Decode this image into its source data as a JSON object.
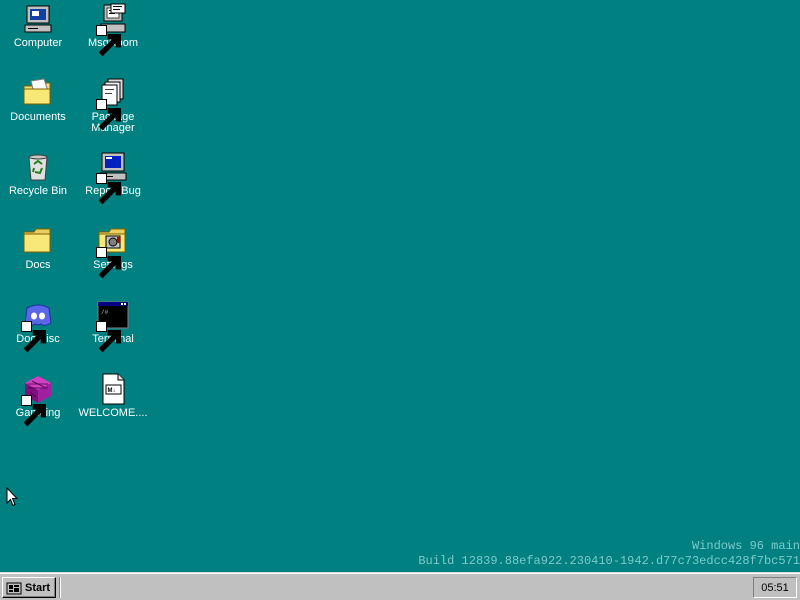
{
  "desktop": {
    "background_color": "#008080",
    "icons": [
      {
        "label": "Computer",
        "icon": "computer-icon",
        "shortcut": false
      },
      {
        "label": "MsgRoom",
        "icon": "msgroom-icon",
        "shortcut": true
      },
      {
        "label": "Documents",
        "icon": "documents-folder-icon",
        "shortcut": false
      },
      {
        "label": "Package Manager",
        "icon": "package-manager-icon",
        "shortcut": true
      },
      {
        "label": "Recycle Bin",
        "icon": "recycle-bin-icon",
        "shortcut": false
      },
      {
        "label": "Report Bug",
        "icon": "report-bug-icon",
        "shortcut": true
      },
      {
        "label": "Docs",
        "icon": "folder-icon",
        "shortcut": false
      },
      {
        "label": "Settings",
        "icon": "settings-icon",
        "shortcut": true
      },
      {
        "label": "Doordisc",
        "icon": "doordisc-icon",
        "shortcut": true
      },
      {
        "label": "Terminal",
        "icon": "terminal-icon",
        "shortcut": true
      },
      {
        "label": "Gameing",
        "icon": "gameing-icon",
        "shortcut": true
      },
      {
        "label": "WELCOME....",
        "icon": "markdown-file-icon",
        "shortcut": false
      }
    ]
  },
  "watermark": {
    "line1": "Windows 96 main",
    "line2": "Build 12839.88efa922.230410-1942.d77c73edcc428f7bc571"
  },
  "taskbar": {
    "start_label": "Start",
    "clock": "05:51"
  }
}
